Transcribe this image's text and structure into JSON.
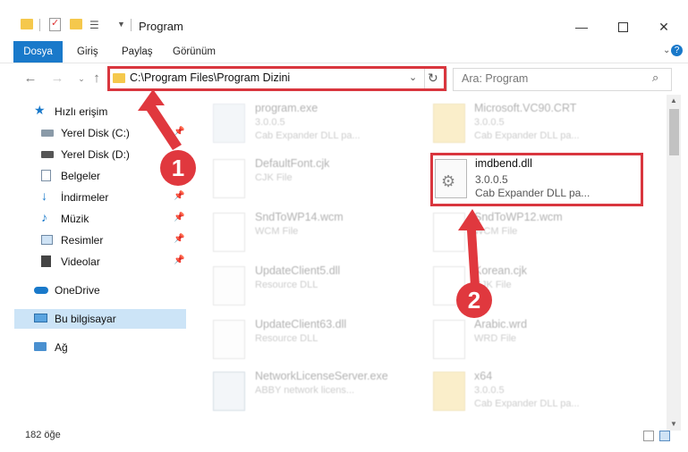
{
  "window": {
    "title": "Program"
  },
  "ribbon": {
    "tabs": [
      "Dosya",
      "Giriş",
      "Paylaş",
      "Görünüm"
    ]
  },
  "address": {
    "path": "C:\\Program Files\\Program Dizini"
  },
  "search": {
    "placeholder": "Ara: Program"
  },
  "sidebar": {
    "items": [
      {
        "label": "Hızlı erişim",
        "icon": "star-icon"
      },
      {
        "label": "Yerel Disk (C:)",
        "icon": "drive-icon",
        "pinned": true
      },
      {
        "label": "Yerel Disk (D:)",
        "icon": "drive-icon"
      },
      {
        "label": "Belgeler",
        "icon": "documents-icon",
        "pinned": true
      },
      {
        "label": "İndirmeler",
        "icon": "download-icon",
        "pinned": true
      },
      {
        "label": "Müzik",
        "icon": "music-icon",
        "pinned": true
      },
      {
        "label": "Resimler",
        "icon": "pictures-icon",
        "pinned": true
      },
      {
        "label": "Videolar",
        "icon": "videos-icon",
        "pinned": true
      },
      {
        "label": "OneDrive",
        "icon": "cloud-icon"
      },
      {
        "label": "Bu bilgisayar",
        "icon": "computer-icon",
        "selected": true
      },
      {
        "label": "Ağ",
        "icon": "network-icon"
      }
    ]
  },
  "files": [
    {
      "name": "program.exe",
      "line1": "3.0.0.5",
      "line2": "Cab Expander DLL pa...",
      "icon": "exe-icon"
    },
    {
      "name": "Microsoft.VC90.CRT",
      "line1": "3.0.0.5",
      "line2": "Cab Expander DLL pa...",
      "icon": "folder-zip-icon"
    },
    {
      "name": "DefaultFont.cjk",
      "line1": "CJK File",
      "line2": "",
      "icon": "file-icon"
    },
    {
      "name": "imdbend.dll",
      "line1": "3.0.0.5",
      "line2": "Cab Expander DLL pa...",
      "icon": "dll-icon"
    },
    {
      "name": "SndToWP14.wcm",
      "line1": "WCM File",
      "line2": "",
      "icon": "file-icon"
    },
    {
      "name": "SndToWP12.wcm",
      "line1": "WCM File",
      "line2": "",
      "icon": "file-icon"
    },
    {
      "name": "UpdateClient5.dll",
      "line1": "Resource DLL",
      "line2": "",
      "icon": "dll-icon"
    },
    {
      "name": "Korean.cjk",
      "line1": "CJK File",
      "line2": "",
      "icon": "file-icon"
    },
    {
      "name": "UpdateClient63.dll",
      "line1": "Resource DLL",
      "line2": "",
      "icon": "dll-icon"
    },
    {
      "name": "Arabic.wrd",
      "line1": "WRD File",
      "line2": "",
      "icon": "file-icon"
    },
    {
      "name": "NetworkLicenseServer.exe",
      "line1": "ABBY network licens...",
      "line2": "",
      "icon": "exe-icon"
    },
    {
      "name": "x64",
      "line1": "3.0.0.5",
      "line2": "Cab Expander DLL pa...",
      "icon": "folder-zip-icon"
    }
  ],
  "status": {
    "count": "182 öğe"
  },
  "annotations": {
    "badge1": "1",
    "badge2": "2"
  },
  "colors": {
    "accent": "#1979ca",
    "annotation": "#d9363e",
    "selected": "#cce4f7"
  }
}
